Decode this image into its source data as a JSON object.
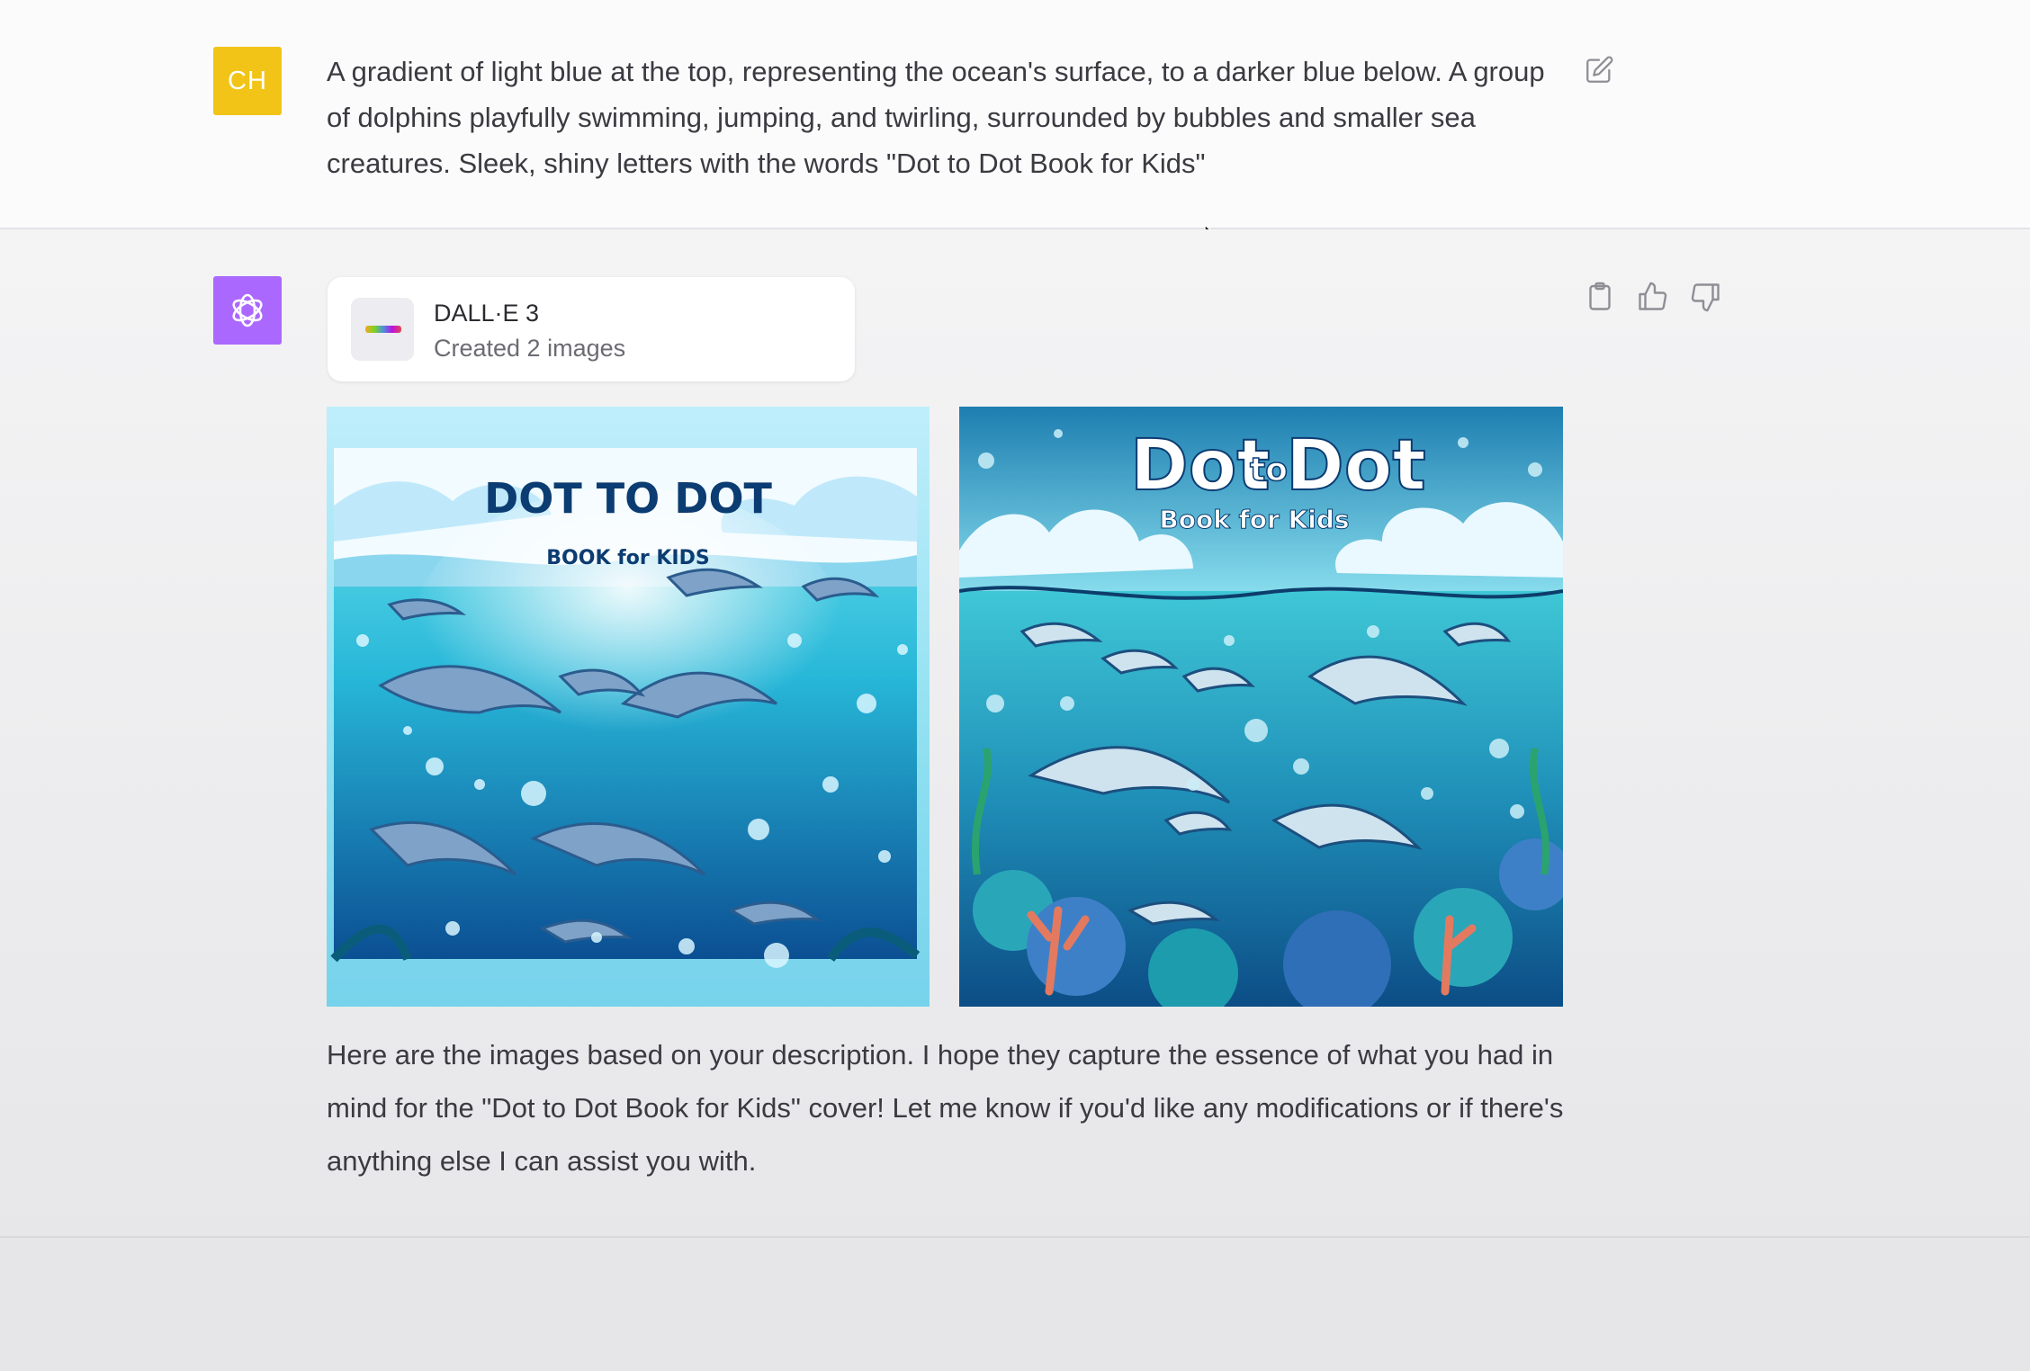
{
  "conversation": {
    "user_message": {
      "avatar_initials": "CH",
      "text": "A gradient of light blue at the top, representing the ocean's surface, to a darker blue below. A group of dolphins playfully swimming, jumping, and twirling, surrounded by bubbles and smaller sea creatures. Sleek, shiny letters with the words \"Dot to Dot Book for Kids\""
    },
    "assistant_message": {
      "tool_card": {
        "name": "DALL·E 3",
        "status": "Created 2 images"
      },
      "images": [
        {
          "title": "DOT TO DOT",
          "subtitle": "BOOK for KIDS"
        },
        {
          "title_1": "Dot",
          "title_to": "to",
          "title_2": "Dot",
          "subtitle": "Book for Kids"
        }
      ],
      "reply": "Here are the images based on your description. I hope they capture the essence of what you had in mind for the \"Dot to Dot Book for Kids\" cover! Let me know if you'd like any modifications or if there's anything else I can assist you with."
    }
  },
  "icons": {
    "edit": "edit-icon",
    "copy": "clipboard-icon",
    "thumbs_up": "thumbs-up-icon",
    "thumbs_down": "thumbs-down-icon",
    "assistant_logo": "openai-logo-icon",
    "cursor": "mouse-cursor-icon"
  },
  "colors": {
    "user_avatar": "#f2c417",
    "assistant_avatar": "#ab68ff"
  }
}
